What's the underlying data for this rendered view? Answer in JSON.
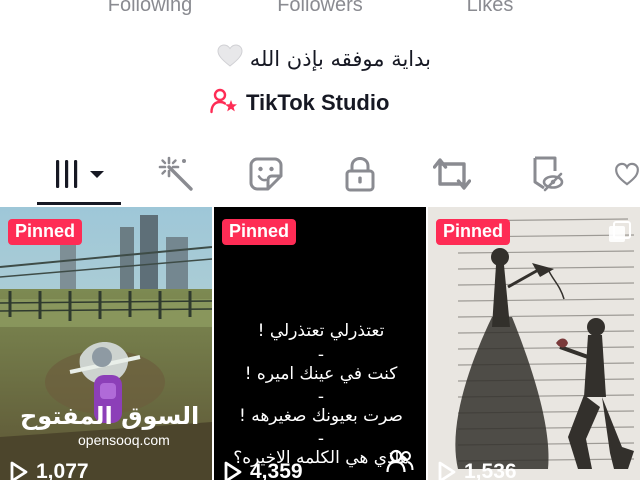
{
  "profile": {
    "stats": [
      {
        "label": "Following"
      },
      {
        "label": "Followers"
      },
      {
        "label": "Likes"
      }
    ],
    "bio": "بداية موفقه بإذن الله",
    "bio_emoji": "white-heart-icon",
    "studio_label": "TikTok Studio"
  },
  "tabs": [
    {
      "icon": "grid-icon",
      "selected": true
    },
    {
      "icon": "sparkle-wand-icon"
    },
    {
      "icon": "sticker-icon"
    },
    {
      "icon": "lock-icon"
    },
    {
      "icon": "repost-icon"
    },
    {
      "icon": "bookmark-hidden-icon"
    },
    {
      "icon": "heart-icon"
    }
  ],
  "videos": [
    {
      "badge": "Pinned",
      "views": "1,077",
      "watermark_ar": "السوق المفتوح",
      "watermark_en": "opensooq.com"
    },
    {
      "badge": "Pinned",
      "views": "4,359",
      "lines": [
        "تعتذرلي تعتذرلي !",
        "-",
        "كنت في عينك اميره !",
        "-",
        "صرت بعيونك صغيرهه !",
        "-",
        "هاذي هي الكلمه الاخيره؟"
      ]
    },
    {
      "badge": "Pinned",
      "views": "1,536"
    }
  ],
  "colors": {
    "accent": "#fe2c55",
    "text": "#161823",
    "muted": "#8a8b91"
  }
}
